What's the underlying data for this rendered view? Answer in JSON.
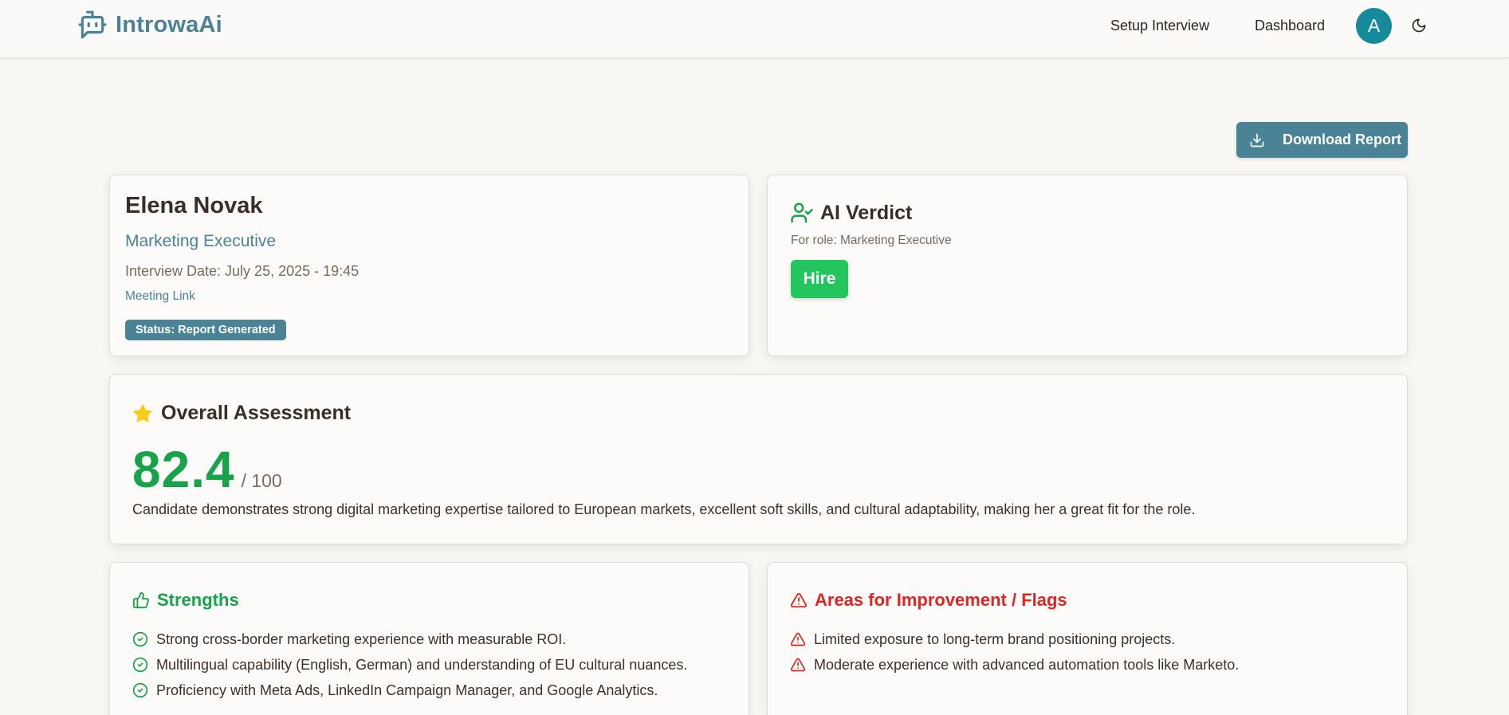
{
  "brand": {
    "name": "IntrowaAi",
    "icon": "bot-chat-icon"
  },
  "nav": {
    "setup_label": "Setup Interview",
    "dashboard_label": "Dashboard",
    "avatar_initial": "A",
    "theme_icon": "moon-icon"
  },
  "actions": {
    "download_label": "Download Report",
    "download_icon": "download-icon"
  },
  "candidate": {
    "name": "Elena Novak",
    "role": "Marketing Executive",
    "interview_date": "Interview Date: July 25, 2025 - 19:45",
    "meeting_link_label": "Meeting Link",
    "status": "Status: Report Generated"
  },
  "verdict": {
    "title": "AI Verdict",
    "icon": "user-check-icon",
    "for_role": "For role: Marketing Executive",
    "decision": "Hire"
  },
  "overall": {
    "title": "Overall Assessment",
    "icon": "star-icon",
    "score": "82.4",
    "score_max": "/ 100",
    "summary": "Candidate demonstrates strong digital marketing expertise tailored to European markets, excellent soft skills, and cultural adaptability, making her a great fit for the role."
  },
  "strengths": {
    "title": "Strengths",
    "icon": "thumbs-up-icon",
    "items": [
      "Strong cross-border marketing experience with measurable ROI.",
      "Multilingual capability (English, German) and understanding of EU cultural nuances.",
      "Proficiency with Meta Ads, LinkedIn Campaign Manager, and Google Analytics."
    ]
  },
  "flags": {
    "title": "Areas for Improvement / Flags",
    "icon": "alert-triangle-icon",
    "items": [
      "Limited exposure to long-term brand positioning projects.",
      "Moderate experience with advanced automation tools like Marketo."
    ]
  },
  "colors": {
    "brand": "#4a8296",
    "avatar": "#148a9a",
    "success": "#22c55e",
    "score": "#16a34a",
    "danger": "#dc2626",
    "star": "#facc15",
    "background": "#f8f7f4"
  }
}
